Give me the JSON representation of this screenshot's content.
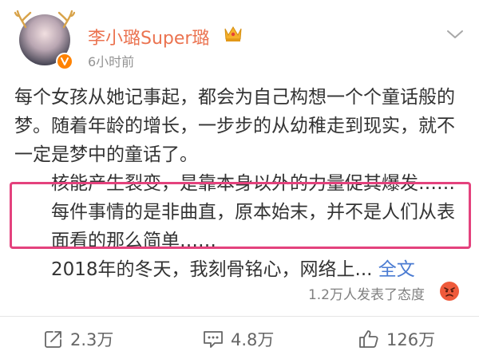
{
  "post": {
    "username": "李小璐Super璐",
    "timestamp": "6小时前",
    "paragraphs": [
      "每个女孩从她记事起，都会为自己构想一个个童话般的梦。随着年龄的增长，一步步的从幼稚走到现实，就不一定是梦中的童话了。",
      "核能产生裂变，是靠本身以外的力量促其爆发……每件事情的是非曲直，原本始末，并不是人们从表面看的那么简单……",
      "2018年的冬天，我刻骨铭心，网络上... "
    ],
    "more_link": "全文",
    "reactions_text": "1.2万人发表了态度"
  },
  "actions": {
    "repost_count": "2.3万",
    "comment_count": "4.8万",
    "like_count": "126万"
  },
  "colors": {
    "username": "#eb7350",
    "highlight_border": "#e4427d",
    "link": "#4a7bd2",
    "verified": "#ff8200"
  }
}
